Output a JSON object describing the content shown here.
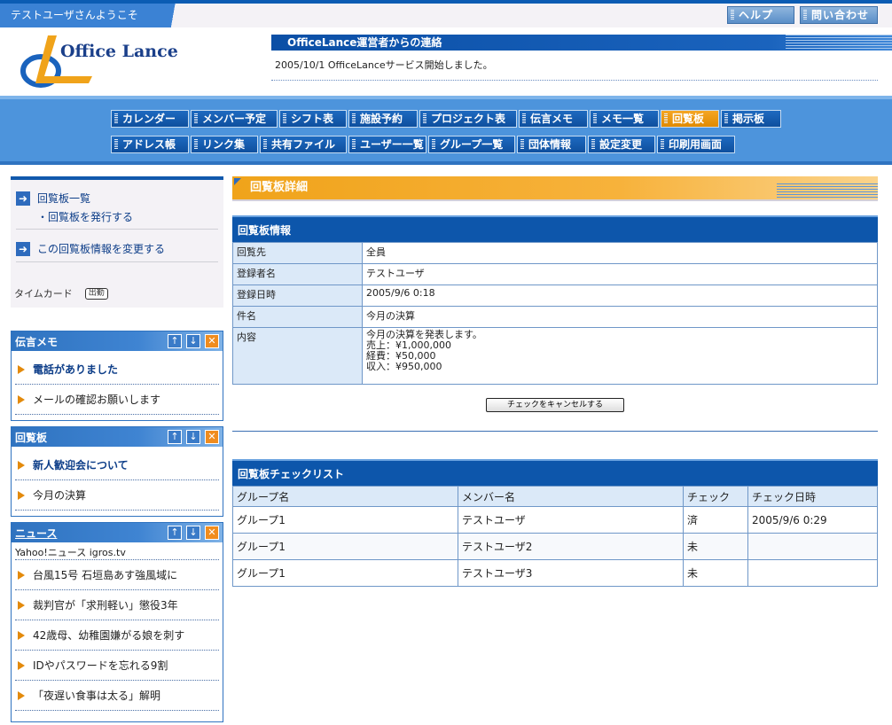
{
  "top": {
    "welcome": "テストユーザさんようこそ",
    "help": "ヘルプ",
    "contact": "問い合わせ"
  },
  "header": {
    "logo_text": "Office Lance",
    "notice_title": "OfficeLance運営者からの連絡",
    "notice_text": "2005/10/1 OfficeLanceサービス開始しました。"
  },
  "nav": {
    "row1": [
      "カレンダー",
      "メンバー予定",
      "シフト表",
      "施設予約",
      "プロジェクト表",
      "伝言メモ",
      "メモ一覧",
      "回覧板",
      "掲示板"
    ],
    "row2": [
      "アドレス帳",
      "リンク集",
      "共有ファイル",
      "ユーザー一覧",
      "グループ一覧",
      "団体情報",
      "設定変更",
      "印刷用画面"
    ],
    "active": "回覧板"
  },
  "leftmenu": {
    "list_link": "回覧板一覧",
    "issue_link": "・回覧板を発行する",
    "edit_link": "この回覧板情報を変更する",
    "timecard_label": "タイムカード",
    "timecard_button": "出勤"
  },
  "panels": {
    "memo": {
      "title": "伝言メモ",
      "items": [
        "電話がありました",
        "メールの確認お願いします"
      ]
    },
    "circular": {
      "title": "回覧板",
      "items": [
        "新人歓迎会について",
        "今月の決算"
      ]
    },
    "news": {
      "title": "ニュース",
      "source": "Yahoo!ニュース igros.tv",
      "items": [
        "台風15号 石垣島あす強風域に",
        "裁判官が「求刑軽い」懲役3年",
        "42歳母、幼稚園嫌がる娘を刺す",
        "IDやパスワードを忘れる9割",
        "「夜遅い食事は太る」解明"
      ]
    }
  },
  "main": {
    "page_title": "回覧板詳細",
    "info_title": "回覧板情報",
    "info_rows": [
      {
        "key": "回覧先",
        "value": "全員"
      },
      {
        "key": "登録者名",
        "value": "テストユーザ"
      },
      {
        "key": "登録日時",
        "value": "2005/9/6 0:18"
      },
      {
        "key": "件名",
        "value": "今月の決算"
      }
    ],
    "content_key": "内容",
    "content_lines": [
      "今月の決算を発表します。",
      "売上：¥1,000,000",
      "経費：¥50,000",
      "収入：¥950,000"
    ],
    "cancel_button": "チェックをキャンセルする",
    "checklist_title": "回覧板チェックリスト",
    "checklist_headers": [
      "グループ名",
      "メンバー名",
      "チェック",
      "チェック日時"
    ],
    "checklist_rows": [
      [
        "グループ1",
        "テストユーザ",
        "済",
        "2005/9/6 0:29"
      ],
      [
        "グループ1",
        "テストユーザ2",
        "未",
        ""
      ],
      [
        "グループ1",
        "テストユーザ3",
        "未",
        ""
      ]
    ]
  }
}
